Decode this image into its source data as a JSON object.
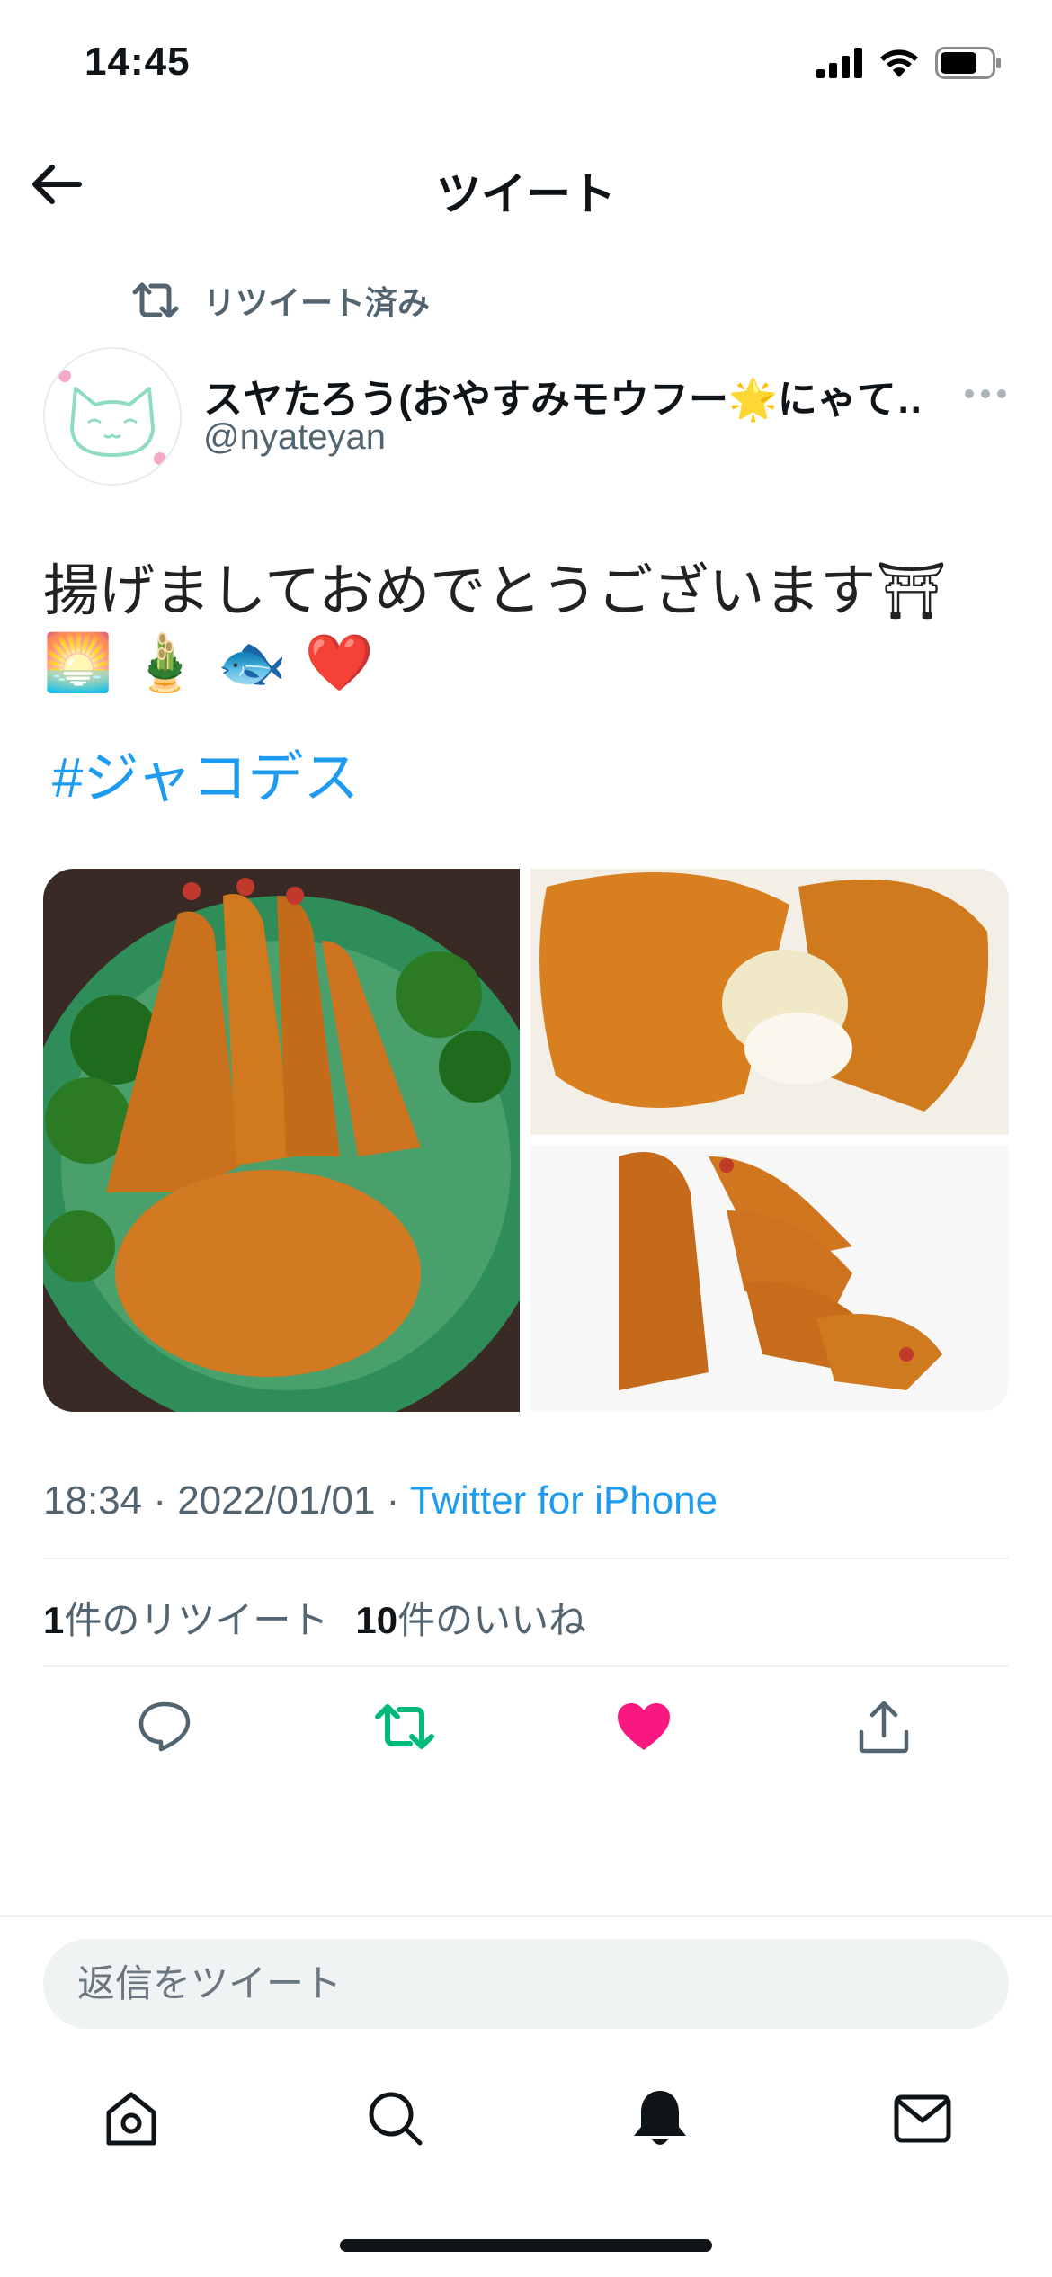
{
  "status_bar": {
    "time": "14:45"
  },
  "header": {
    "title": "ツイート"
  },
  "retweet_note": "リツイート済み",
  "author": {
    "name": "スヤたろう(おやすみモウフー🌟にゃて…",
    "handle": "@nyateyan"
  },
  "tweet": {
    "line1": "揚げましておめでとうございます⛩",
    "line2": "🌅 🎍 🐟 ❤️",
    "hashtag": "#ジャコデス"
  },
  "meta": {
    "time": "18:34 · 2022/01/01 · ",
    "source": "Twitter for iPhone"
  },
  "stats": {
    "retweets": "1",
    "retweets_label": "件のリツイート",
    "likes": "10",
    "likes_label": "件のいいね"
  },
  "actions": {
    "retweeted": true,
    "liked": true,
    "colors": {
      "retweet": "#00ba7c",
      "like": "#f91880",
      "neutral": "#536471"
    }
  },
  "reply": {
    "placeholder": "返信をツイート"
  },
  "tabs": [
    "home-icon",
    "search-icon",
    "notifications-icon",
    "messages-icon"
  ],
  "colors": {
    "link": "#1d9bf0"
  }
}
